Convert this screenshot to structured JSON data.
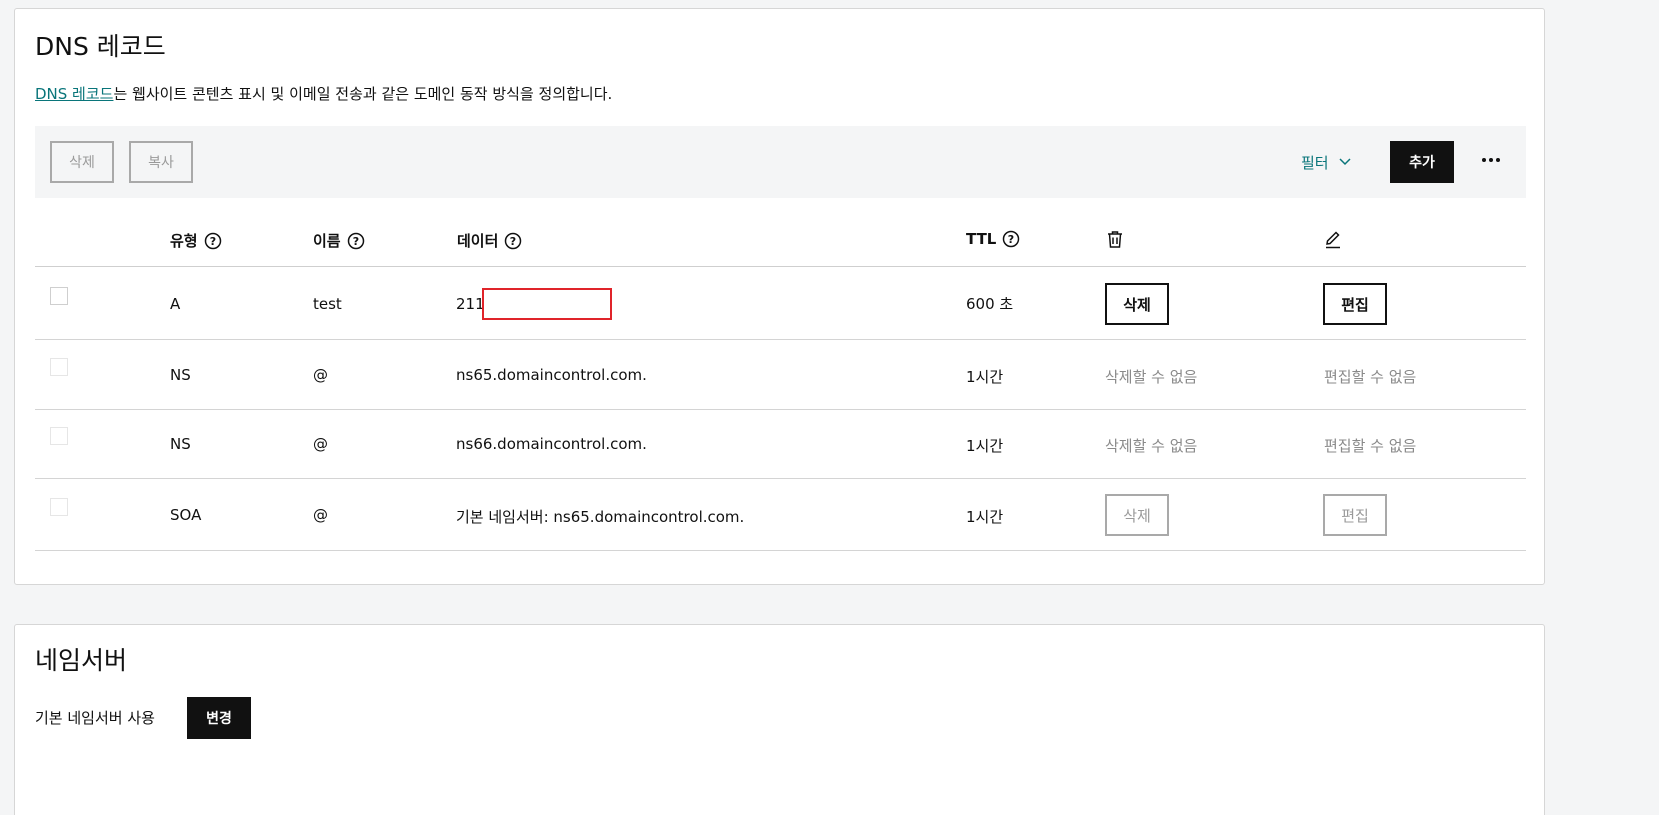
{
  "dns": {
    "title": "DNS 레코드",
    "desc_link": "DNS 레코드",
    "desc_rest": "는 웹사이트 콘텐츠 표시 및 이메일 전송과 같은 도메인 동작 방식을 정의합니다.",
    "toolbar": {
      "delete_label": "삭제",
      "copy_label": "복사",
      "filter_label": "필터",
      "add_label": "추가",
      "more_icon": "more-horizontal-icon"
    },
    "columns": {
      "type": "유형",
      "name": "이름",
      "data": "데이터",
      "ttl": "TTL",
      "delete_icon": "trash-icon",
      "edit_icon": "pencil-icon"
    },
    "rows": [
      {
        "type": "A",
        "name": "test",
        "data": "211",
        "ttl": "600 초",
        "delete": "삭제",
        "edit": "편집"
      },
      {
        "type": "NS",
        "name": "@",
        "data": "ns65.domaincontrol.com.",
        "ttl": "1시간",
        "delete": "삭제할 수 없음",
        "edit": "편집할 수 없음"
      },
      {
        "type": "NS",
        "name": "@",
        "data": "ns66.domaincontrol.com.",
        "ttl": "1시간",
        "delete": "삭제할 수 없음",
        "edit": "편집할 수 없음"
      },
      {
        "type": "SOA",
        "name": "@",
        "data": "기본 네임서버: ns65.domaincontrol.com.",
        "ttl": "1시간",
        "delete": "삭제",
        "edit": "편집"
      }
    ]
  },
  "nameservers": {
    "title": "네임서버",
    "label": "기본 네임서버 사용",
    "change_label": "변경"
  },
  "colors": {
    "link": "#09757a",
    "primary_button": "#111111",
    "redaction_box": "#e0242a"
  }
}
